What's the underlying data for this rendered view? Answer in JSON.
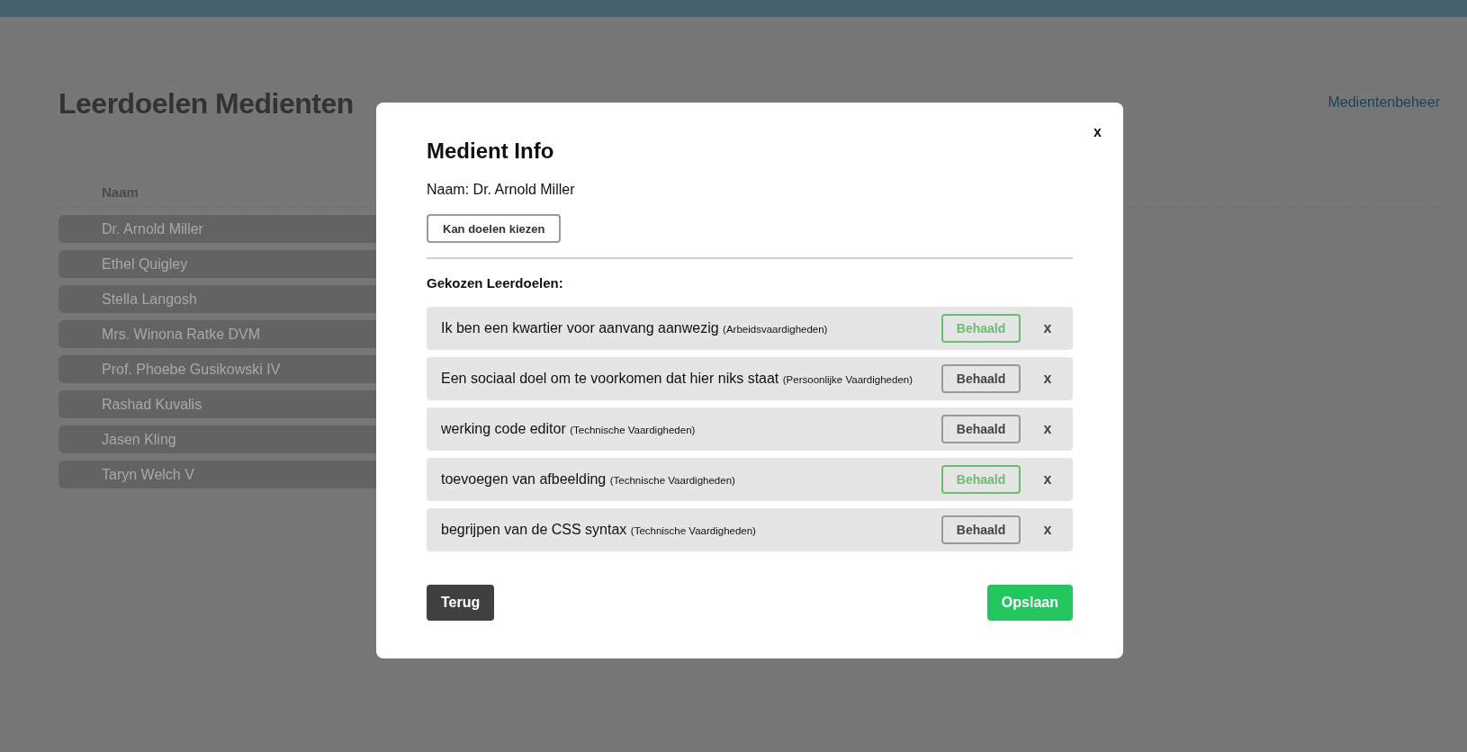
{
  "page": {
    "title": "Leerdoelen Medienten",
    "nav_link": "Medientenbeheer"
  },
  "table": {
    "columns": [
      "Naam"
    ],
    "rows": [
      {
        "name": "Dr. Arnold Miller"
      },
      {
        "name": "Ethel Quigley"
      },
      {
        "name": "Stella Langosh"
      },
      {
        "name": "Mrs. Winona Ratke DVM"
      },
      {
        "name": "Prof. Phoebe Gusikowski IV"
      },
      {
        "name": "Rashad Kuvalis"
      },
      {
        "name": "Jasen Kling"
      },
      {
        "name": "Taryn Welch V"
      }
    ]
  },
  "modal": {
    "close": "x",
    "title": "Medient Info",
    "name_line": "Naam: Dr. Arnold Miller",
    "choose_button": "Kan doelen kiezen",
    "section_title": "Gekozen Leerdoelen:",
    "goals": [
      {
        "title": "Ik ben een kwartier voor aanvang aanwezig",
        "category": "(Arbeidsvaardigheden)",
        "achieve_label": "Behaald",
        "achieved": true,
        "remove": "x"
      },
      {
        "title": "Een sociaal doel om te voorkomen dat hier niks staat",
        "category": "(Persoonlijke Vaardigheden)",
        "achieve_label": "Behaald",
        "achieved": false,
        "remove": "x"
      },
      {
        "title": "werking code editor",
        "category": "(Technische Vaardigheden)",
        "achieve_label": "Behaald",
        "achieved": false,
        "remove": "x"
      },
      {
        "title": "toevoegen van afbeelding",
        "category": "(Technische Vaardigheden)",
        "achieve_label": "Behaald",
        "achieved": true,
        "remove": "x"
      },
      {
        "title": "begrijpen van de CSS syntax",
        "category": "(Technische Vaardigheden)",
        "achieve_label": "Behaald",
        "achieved": false,
        "remove": "x"
      }
    ],
    "back_button": "Terug",
    "save_button": "Opslaan"
  }
}
